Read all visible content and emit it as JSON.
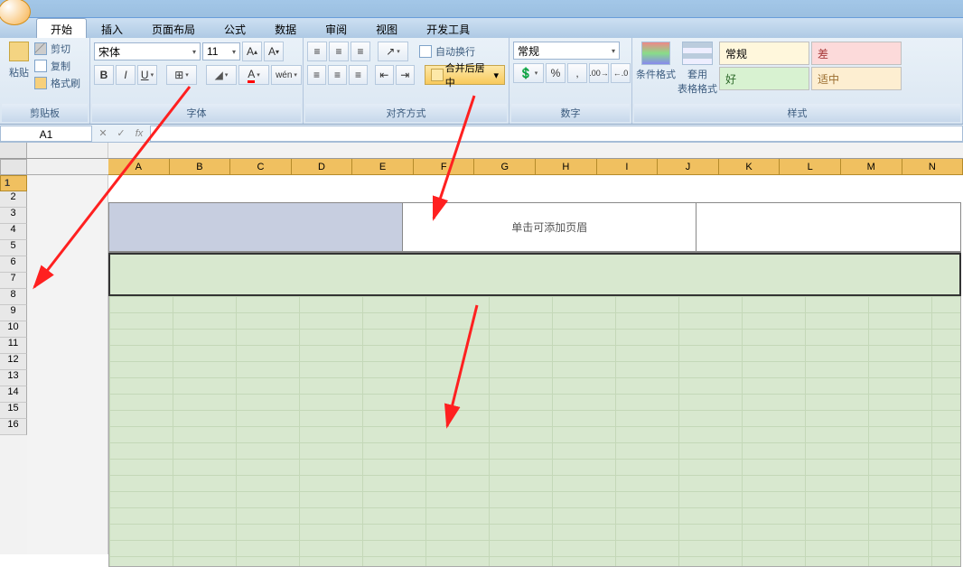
{
  "tabs": {
    "start": "开始",
    "insert": "插入",
    "pagelayout": "页面布局",
    "formula": "公式",
    "data": "数据",
    "review": "审阅",
    "view": "视图",
    "dev": "开发工具"
  },
  "clipboard": {
    "label": "剪贴板",
    "paste": "粘贴",
    "cut": "剪切",
    "copy": "复制",
    "format": "格式刷"
  },
  "font": {
    "label": "字体",
    "name": "宋体",
    "size": "11"
  },
  "align": {
    "label": "对齐方式",
    "wrap": "自动换行",
    "merge": "合并后居中"
  },
  "number": {
    "label": "数字",
    "general": "常规"
  },
  "styles": {
    "label": "样式",
    "cond": "条件格式",
    "table": "套用\n表格格式",
    "normal": "常规",
    "bad": "差",
    "good": "好",
    "mid": "适中"
  },
  "formula_bar": {
    "cell": "A1"
  },
  "columns": [
    "A",
    "B",
    "C",
    "D",
    "E",
    "F",
    "G",
    "H",
    "I",
    "J",
    "K",
    "L",
    "M",
    "N"
  ],
  "rows": [
    "1",
    "2",
    "3",
    "4",
    "5",
    "6",
    "7",
    "8",
    "9",
    "10",
    "11",
    "12",
    "13",
    "14",
    "15",
    "16"
  ],
  "header_hint": "单击可添加页眉"
}
